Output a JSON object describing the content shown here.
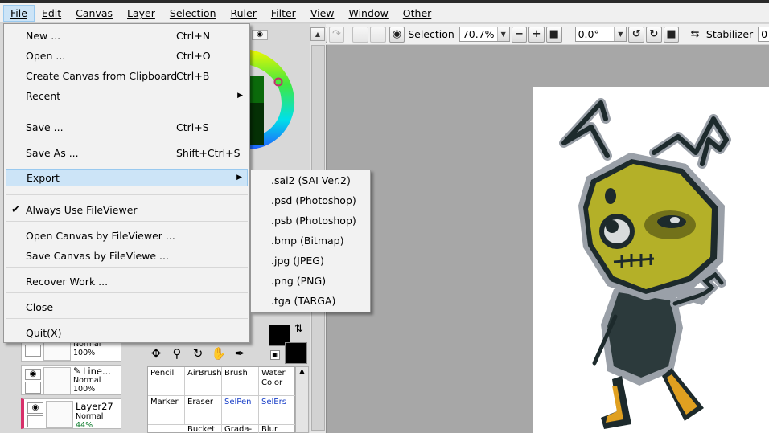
{
  "menubar": {
    "items": [
      "File",
      "Edit",
      "Canvas",
      "Layer",
      "Selection",
      "Ruler",
      "Filter",
      "View",
      "Window",
      "Other"
    ],
    "active": "File"
  },
  "file_menu": {
    "new": {
      "label": "New ...",
      "shortcut": "Ctrl+N"
    },
    "open": {
      "label": "Open ...",
      "shortcut": "Ctrl+O"
    },
    "create_from_clipboard": {
      "label": "Create Canvas from Clipboard",
      "shortcut": "Ctrl+B"
    },
    "recent": {
      "label": "Recent"
    },
    "save": {
      "label": "Save ...",
      "shortcut": "Ctrl+S"
    },
    "save_as": {
      "label": "Save As ...",
      "shortcut": "Shift+Ctrl+S"
    },
    "export": {
      "label": "Export"
    },
    "always_use_fileviewer": {
      "label": "Always Use FileViewer",
      "checked": true
    },
    "open_by_fileviewer": {
      "label": "Open Canvas by FileViewer ..."
    },
    "save_by_fileviewer": {
      "label": "Save Canvas by FileViewe ..."
    },
    "recover_work": {
      "label": "Recover Work ..."
    },
    "close": {
      "label": "Close"
    },
    "quit": {
      "label": "Quit(X)"
    }
  },
  "export_submenu": [
    ".sai2 (SAI Ver.2)",
    ".psd (Photoshop)",
    ".psb (Photoshop)",
    ".bmp (Bitmap)",
    ".jpg (JPEG)",
    ".png (PNG)",
    ".tga (TARGA)"
  ],
  "toolbar": {
    "selection_label": "Selection",
    "zoom": "70.7%",
    "rotation": "0.0°",
    "stabilizer_label": "Stabilizer",
    "stabilizer_value": "0"
  },
  "layers": [
    {
      "name": "",
      "mode": "Normal",
      "opacity": "100%"
    },
    {
      "name": "Line...",
      "mode": "Normal",
      "opacity": "100%"
    },
    {
      "name": "Layer27",
      "mode": "Normal",
      "opacity": "44%"
    }
  ],
  "brushes": [
    {
      "name": "Pencil",
      "color": "#000000"
    },
    {
      "name": "AirBrush",
      "color": "#000000"
    },
    {
      "name": "Brush",
      "color": "#000000"
    },
    {
      "name": "Water Color",
      "color": "#000000"
    },
    {
      "name": "Marker",
      "color": "#000000"
    },
    {
      "name": "Eraser",
      "color": "#000000"
    },
    {
      "name": "SelPen",
      "color": "#1a40c8"
    },
    {
      "name": "SelErs",
      "color": "#1a40c8"
    },
    {
      "name": "Bucket",
      "color": "#000000"
    },
    {
      "name": "Grada-",
      "color": "#000000"
    },
    {
      "name": "Blur",
      "color": "#000000"
    }
  ],
  "colors": {
    "primary": "#000000",
    "secondary": "#000000",
    "menu_highlight": "#cce4f7",
    "canvas_bg": "#a7a7a7"
  }
}
